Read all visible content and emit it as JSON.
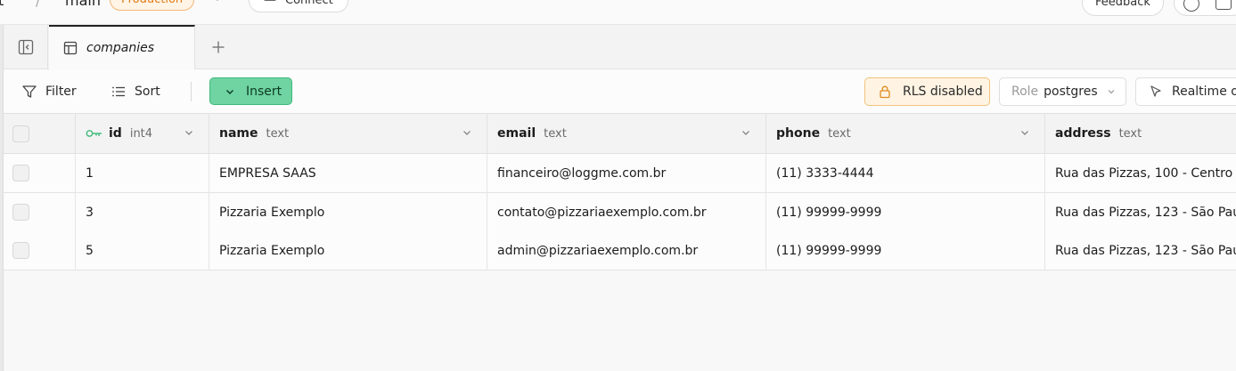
{
  "topbar": {
    "crumb_fragment": "t",
    "separator": "/",
    "branch": "main",
    "environment_badge": "Production",
    "connect_label": "Connect",
    "feedback_label": "Feedback"
  },
  "tabs": [
    {
      "label": "companies",
      "icon": "table-icon",
      "active": true
    }
  ],
  "toolbar": {
    "filter_label": "Filter",
    "sort_label": "Sort",
    "insert_label": "Insert",
    "rls_label": "RLS disabled",
    "role_label": "Role",
    "role_value": "postgres",
    "realtime_label": "Realtime o"
  },
  "table": {
    "columns": [
      {
        "name": "id",
        "type": "int4",
        "primary_key": true
      },
      {
        "name": "name",
        "type": "text"
      },
      {
        "name": "email",
        "type": "text"
      },
      {
        "name": "phone",
        "type": "text"
      },
      {
        "name": "address",
        "type": "text"
      }
    ],
    "rows": [
      {
        "id": "1",
        "name": "EMPRESA SAAS",
        "email": "financeiro@loggme.com.br",
        "phone": "(11) 3333-4444",
        "address": "Rua das Pizzas, 100 - Centro"
      },
      {
        "id": "3",
        "name": "Pizzaria Exemplo",
        "email": "contato@pizzariaexemplo.com.br",
        "phone": "(11) 99999-9999",
        "address": "Rua das Pizzas, 123 - São Pau"
      },
      {
        "id": "5",
        "name": "Pizzaria Exemplo",
        "email": "admin@pizzariaexemplo.com.br",
        "phone": "(11) 99999-9999",
        "address": "Rua das Pizzas, 123 - São Pau"
      }
    ]
  },
  "colors": {
    "insert_bg": "#6fd3a2",
    "rls_bg": "#fff4e3",
    "badge_text": "#e07b18",
    "key_icon": "#3fb97c"
  }
}
